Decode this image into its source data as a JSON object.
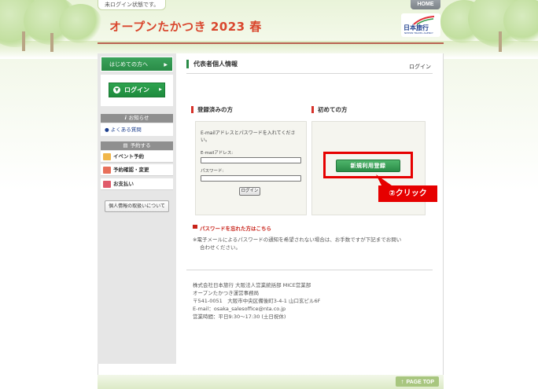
{
  "header": {
    "login_status": "未ログイン状態です。",
    "home_label": "HOME",
    "site_title": "オープンたかつき 2023 春",
    "brand_name": "日本旅行",
    "brand_sub": "NIPPON TRAVEL AGENCY"
  },
  "sidebar": {
    "first_time_tab": "はじめての方へ",
    "login_button": "ログイン",
    "news_heading": "お知らせ",
    "faq_link": "よくある質問",
    "reserve_heading": "予約する",
    "menu": [
      {
        "label": "イベント予約",
        "icon": "event-icon",
        "color": "#f0b64a"
      },
      {
        "label": "予約確認・変更",
        "icon": "check-icon",
        "color": "#e8705a"
      },
      {
        "label": "お支払い",
        "icon": "payment-icon",
        "color": "#e05a6a"
      }
    ],
    "privacy_button": "個人情報の取扱いについて"
  },
  "main": {
    "page_heading": "代表者個人情報",
    "top_right_login": "ログイン",
    "registered": {
      "title": "登録済みの方",
      "instruction": "E-mailアドレスとパスワードを入れてください。",
      "email_label": "E-mailアドレス:",
      "email_value": "",
      "password_label": "パスワード:",
      "password_value": "",
      "login_button": "ログイン"
    },
    "new_user": {
      "title": "初めての方",
      "register_button": "新規利用登録"
    },
    "callout": "②クリック",
    "forgot_password": "パスワードを忘れた方はこちら",
    "notice_line1": "※電子メールによるパスワードの通知を希望されない場合は、お手数ですが下記までお問い",
    "notice_line2": "合わせください。"
  },
  "footer": {
    "lines": [
      "株式会社日本旅行 大阪法人営業統括部 MICE営業部",
      "オープンたかつき運営事務局",
      "〒541-0051　大阪市中央区備後町3-4-1 山口玄ビル6F",
      "E-mail：osaka_salesoffice@nta.co.jp",
      "営業時間：平日9:30〜17:30 (土日祝休)"
    ],
    "page_top": "PAGE TOP"
  },
  "colors": {
    "accent_green": "#2a8b47",
    "title_red": "#d9462d",
    "highlight_red": "#e60000"
  }
}
